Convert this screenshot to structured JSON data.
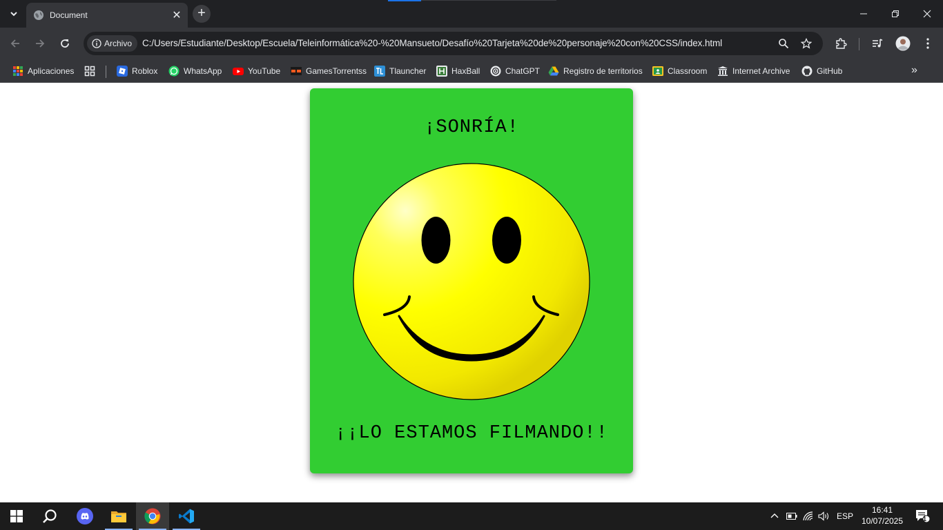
{
  "browser": {
    "tab": {
      "title": "Document"
    },
    "omnibox": {
      "chip_label": "Archivo",
      "url": "C:/Users/Estudiante/Desktop/Escuela/Teleinformática%20-%20Mansueto/Desafío%20Tarjeta%20de%20personaje%20con%20CSS/index.html"
    },
    "bookmarks": [
      {
        "label": "Aplicaciones",
        "icon": "apps-grid-icon"
      },
      {
        "label": "Roblox",
        "icon": "roblox-icon"
      },
      {
        "label": "WhatsApp",
        "icon": "whatsapp-icon"
      },
      {
        "label": "YouTube",
        "icon": "youtube-icon"
      },
      {
        "label": "GamesTorrentss",
        "icon": "gamestorrents-icon"
      },
      {
        "label": "Tlauncher",
        "icon": "tlauncher-icon"
      },
      {
        "label": "HaxBall",
        "icon": "haxball-icon"
      },
      {
        "label": "ChatGPT",
        "icon": "chatgpt-icon"
      },
      {
        "label": "Registro de territorios",
        "icon": "drive-icon"
      },
      {
        "label": "Classroom",
        "icon": "classroom-icon"
      },
      {
        "label": "Internet Archive",
        "icon": "archive-icon"
      },
      {
        "label": "GitHub",
        "icon": "github-icon"
      }
    ]
  },
  "page": {
    "card": {
      "title": "¡SONRÍA!",
      "footer": "¡¡LO ESTAMOS FILMANDO!!",
      "background": "#32cd32",
      "face_color": "#ffff00"
    }
  },
  "taskbar": {
    "apps": [
      "start-icon",
      "search-icon",
      "discord-icon",
      "file-explorer-icon",
      "chrome-icon",
      "vscode-icon"
    ],
    "language": "ESP",
    "time": "16:41",
    "date": "10/07/2025",
    "notification_count": "1"
  }
}
